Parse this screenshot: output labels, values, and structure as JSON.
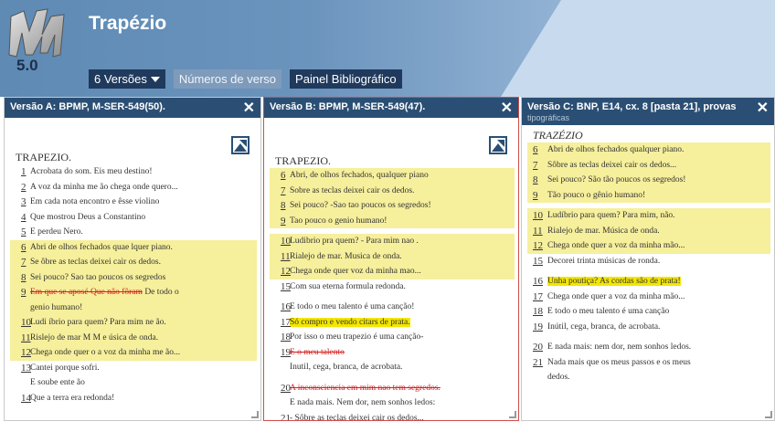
{
  "app": {
    "title": "Trapézio",
    "logo_letters": "VM",
    "logo_version": "5.0"
  },
  "toolbar": {
    "versions_label": "6 Versões",
    "verse_numbers_label": "Números de verso",
    "bibliographic_panel_label": "Painel Bibliográfico"
  },
  "panels": [
    {
      "header": "Versão A: BPMP, M-SER-549(50).",
      "title": "TRAPEZIO.",
      "lines": [
        {
          "num": "1",
          "text": "Acrobata do som. Eis meu destino!",
          "hl": false
        },
        {
          "num": "2",
          "text": "A voz da minha me ão chega onde quero...",
          "hl": false
        },
        {
          "num": "3",
          "text": "Em cada nota encontro e êsse violino",
          "hl": false
        },
        {
          "num": "4",
          "text": "Que mostrou Deus a Constantino",
          "hl": false
        },
        {
          "num": "5",
          "text": "E perdeu Nero.",
          "hl": false
        },
        {
          "num": "6",
          "text": "Abri de olhos fechados quae lquer piano.",
          "hl": true
        },
        {
          "num": "7",
          "text": "Se ôbre as teclas deixei cair os dedos.",
          "hl": true
        },
        {
          "num": "8",
          "text": "Sei pouco? Sao tao poucos os segredos",
          "hl": true
        },
        {
          "num": "9",
          "text": "Em que se aposé Que não fôram De todo o",
          "hl": true,
          "strike": "Em que se aposé Que não fôram",
          "rest": " De todo o"
        },
        {
          "num": "",
          "text": "genio humano!",
          "hl": true
        },
        {
          "num": "10",
          "text": "Ludi íbrio para quem? Para mim ne ão.",
          "hl": true
        },
        {
          "num": "11",
          "text": "Rislejo de mar M M e úsica de onda.",
          "hl": true
        },
        {
          "num": "12",
          "text": "Chega onde quer o a voz da minha me ão...",
          "hl": true
        },
        {
          "num": "13",
          "text": "Cantei porque sofri.",
          "hl": false
        },
        {
          "num": "",
          "text": "E soube ente ão",
          "hl": false
        },
        {
          "num": "14",
          "text": "Que a terra era redonda!",
          "hl": false
        }
      ]
    },
    {
      "header": "Versão B: BPMP, M-SER-549(47).",
      "title": "TRAPEZIO.",
      "lines": [
        {
          "num": "6",
          "text": "Abri, de olhos fechados, qualquer piano",
          "hl": true,
          "gapBefore": false
        },
        {
          "num": "7",
          "text": "Sobre as teclas deixei cair os dedos.",
          "hl": true
        },
        {
          "num": "8",
          "text": "Sei pouco? -Sao tao poucos os segredos!",
          "hl": true
        },
        {
          "num": "9",
          "text": "Tao pouco o genio humano!",
          "hl": true
        },
        {
          "num": "10",
          "text": "Ludibrio pra quem? - Para mim nao .",
          "hl": true,
          "gapBefore": true
        },
        {
          "num": "11",
          "text": "Rialejo de mar. Musica de onda.",
          "hl": true
        },
        {
          "num": "12",
          "text": "Chega onde quer voz da minha mao...",
          "hl": true
        },
        {
          "num": "15",
          "text": "Com sua eterna formula redonda.",
          "hl": false
        },
        {
          "num": "16",
          "text": "E todo o meu talento é uma canção!",
          "hl": false,
          "gapBefore": true
        },
        {
          "num": "17",
          "text": "Só compro e vendo citars de prata.",
          "hl": false,
          "strong": true
        },
        {
          "num": "18",
          "text": "Por isso o meu trapezio é uma canção-",
          "hl": false
        },
        {
          "num": "19",
          "text": "E o meu talento",
          "hl": false,
          "strike": "E o meu talento"
        },
        {
          "num": "",
          "text": "Inutil, cega, branca, de acrobata.",
          "hl": false
        },
        {
          "num": "20",
          "text": "A inconsciencia em mim nao tem segredos.",
          "hl": false,
          "strike": "A inconsciencia em mim nao tem segredos.",
          "gapBefore": true
        },
        {
          "num": "",
          "text": "E nada mais. Nem dor, nem sonhos ledos:",
          "hl": false
        },
        {
          "num": "21",
          "text": "- Sôbre as teclas deixei cair os dedos...",
          "hl": false
        }
      ]
    },
    {
      "header": "Versão C: BNP, E14, cx. 8 [pasta 21], provas",
      "header_sub": "tipográficas",
      "title": "TRAZÉZIO",
      "lines": [
        {
          "num": "6",
          "text": "Abri de olhos fechados qualquer piano.",
          "hl": true
        },
        {
          "num": "7",
          "text": "Sôbre as teclas deixei cair os dedos...",
          "hl": true
        },
        {
          "num": "8",
          "text": "Sei pouco? São tão poucos os segredos!",
          "hl": true
        },
        {
          "num": "9",
          "text": "Tão pouco o gênio humano!",
          "hl": true
        },
        {
          "num": "10",
          "text": "Ludíbrio para quem? Para mim, não.",
          "hl": true,
          "gapBefore": true
        },
        {
          "num": "11",
          "text": "Rialejo de mar. Música de onda.",
          "hl": true
        },
        {
          "num": "12",
          "text": "Chega onde quer a voz da minha mão...",
          "hl": true
        },
        {
          "num": "15",
          "text": "Decorei trinta músicas de ronda.",
          "hl": false
        },
        {
          "num": "16",
          "text": "Unha poutiça? As cordas são de prata!",
          "hl": false,
          "strong": true,
          "gapBefore": true
        },
        {
          "num": "17",
          "text": "Chega onde quer a voz da minha mão...",
          "hl": false
        },
        {
          "num": "18",
          "text": "E todo o meu talento é uma canção",
          "hl": false
        },
        {
          "num": "19",
          "text": "Inútil, cega, branca, de acrobata.",
          "hl": false
        },
        {
          "num": "20",
          "text": "E nada mais: nem dor, nem sonhos ledos.",
          "hl": false,
          "gapBefore": true
        },
        {
          "num": "21",
          "text": "Nada mais que os meus passos e os meus",
          "hl": false
        },
        {
          "num": "",
          "text": "dedos.",
          "hl": false
        }
      ]
    }
  ],
  "colors": {
    "header_bar": "#2b4f74",
    "highlight": "#f6ef9c",
    "highlight_strong": "#f3e600",
    "deletion": "#d42020"
  }
}
